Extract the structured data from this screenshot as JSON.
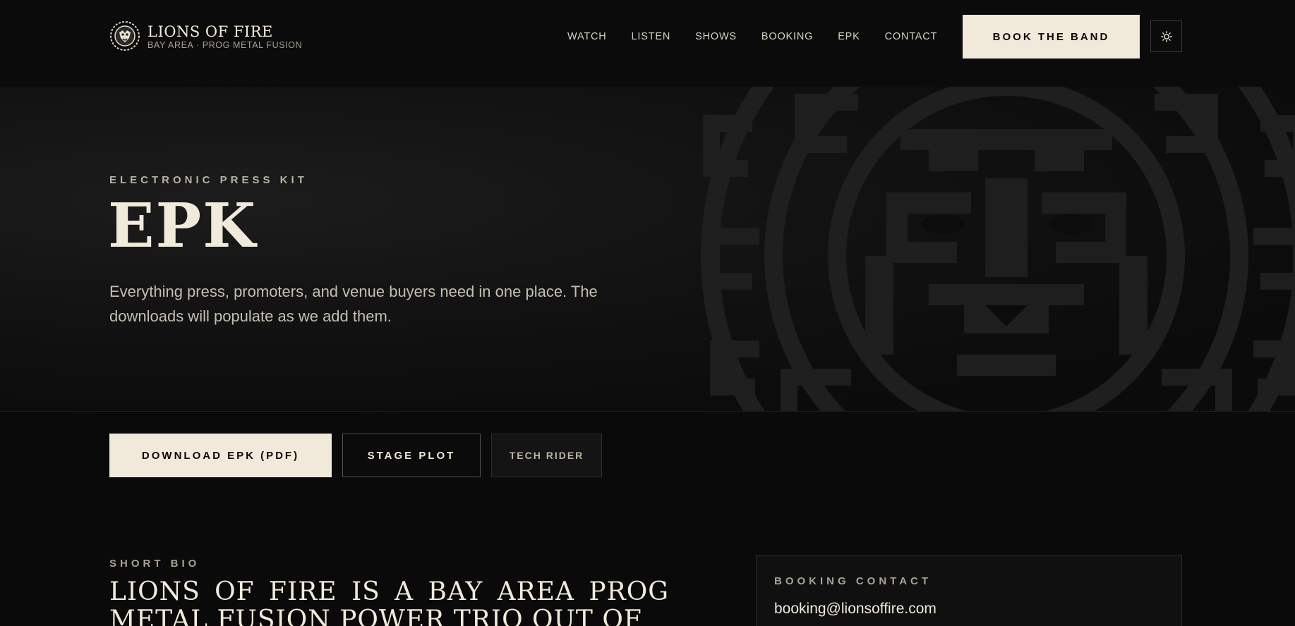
{
  "header": {
    "brand_name": "LIONS OF FIRE",
    "brand_tagline": "BAY AREA · PROG METAL FUSION",
    "nav": [
      "WATCH",
      "LISTEN",
      "SHOWS",
      "BOOKING",
      "EPK",
      "CONTACT"
    ],
    "cta_label": "BOOK THE BAND",
    "theme_icon": "sun-icon"
  },
  "hero": {
    "eyebrow": "ELECTRONIC PRESS KIT",
    "title": "EPK",
    "description": "Everything press, promoters, and venue buyers need in one place. The downloads will populate as we add them."
  },
  "actions": {
    "download_label": "DOWNLOAD EPK (PDF)",
    "stage_plot_label": "STAGE PLOT",
    "tech_rider_label": "TECH RIDER"
  },
  "bio": {
    "label": "SHORT BIO",
    "text": "Lions of Fire is a Bay Area prog metal fusion power trio out of"
  },
  "booking_card": {
    "label": "BOOKING CONTACT",
    "email": "booking@lionsoffire.com"
  },
  "colors": {
    "background": "#0a0a0a",
    "cream": "#f1eadb",
    "muted": "#a9a294"
  }
}
